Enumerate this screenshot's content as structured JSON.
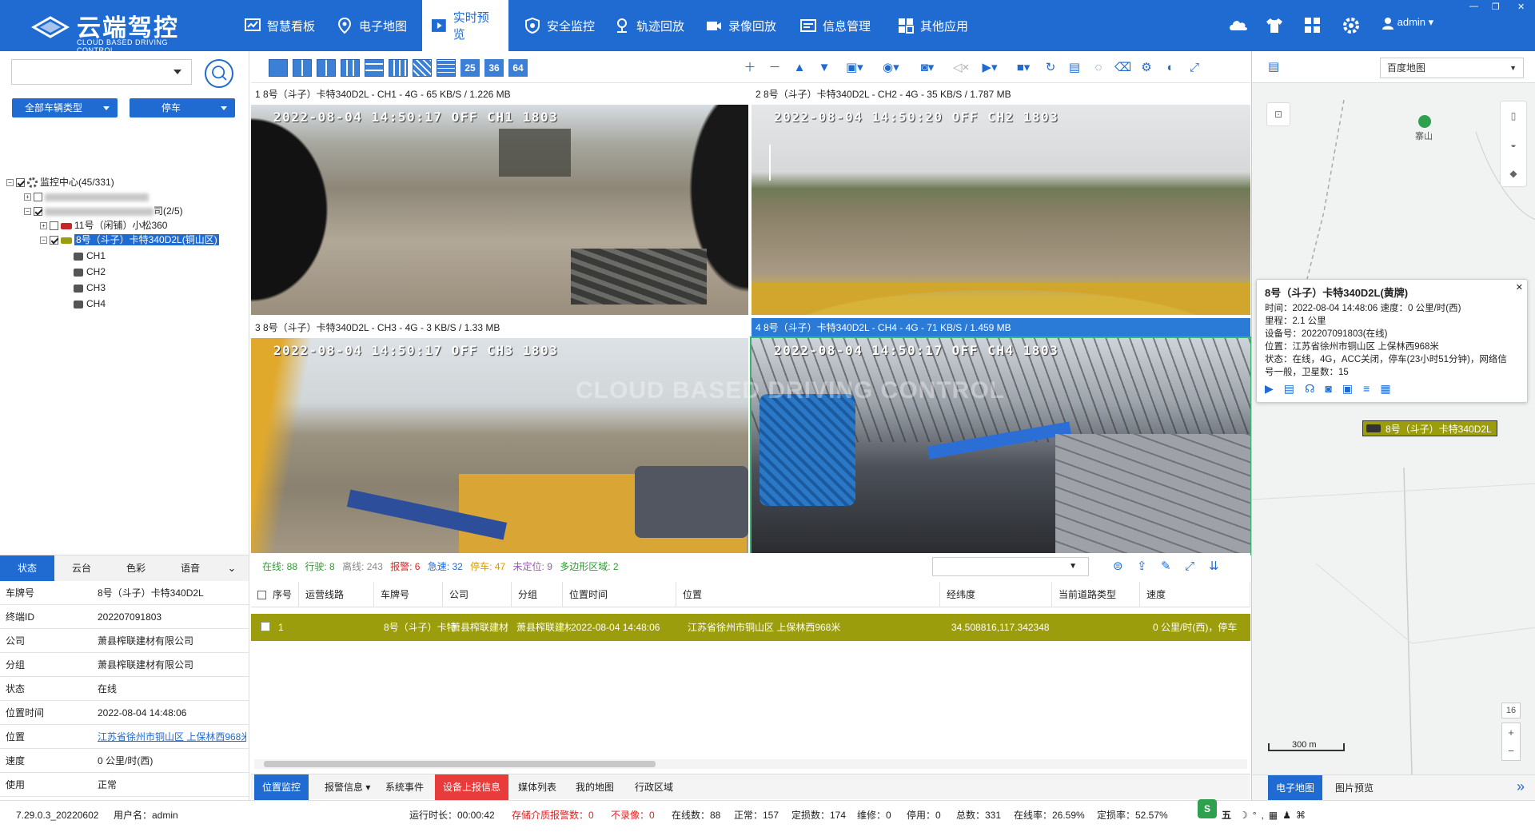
{
  "app": {
    "logo_main": "云端驾控",
    "logo_sub": "CLOUD BASED DRIVING CONTROL"
  },
  "nav": [
    {
      "label": "智慧看板",
      "icon": "chart-board-icon"
    },
    {
      "label": "电子地图",
      "icon": "map-pin-icon"
    },
    {
      "label": "实时预览",
      "icon": "play-screen-icon",
      "active": true
    },
    {
      "label": "安全监控",
      "icon": "shield-icon"
    },
    {
      "label": "轨迹回放",
      "icon": "location-icon"
    },
    {
      "label": "录像回放",
      "icon": "video-camera-icon"
    },
    {
      "label": "信息管理",
      "icon": "id-card-icon"
    },
    {
      "label": "其他应用",
      "icon": "apps-grid-icon"
    }
  ],
  "user": {
    "name": "admin"
  },
  "left": {
    "vehicle_type_btn": "全部车辆类型",
    "status_btn": "停车",
    "tree": {
      "root": "监控中心(45/331)",
      "group2_count": "司(2/5)",
      "vehicle11": "11号（闲铺）小松360",
      "vehicle8": "8号（斗子）卡特340D2L(铜山区)",
      "channels": [
        "CH1",
        "CH2",
        "CH3",
        "CH4"
      ]
    }
  },
  "info_tabs": [
    "状态",
    "云台",
    "色彩",
    "语音"
  ],
  "info": [
    {
      "k": "车牌号",
      "v": "8号（斗子）卡特340D2L"
    },
    {
      "k": "终端ID",
      "v": "202207091803"
    },
    {
      "k": "公司",
      "v": "萧县榨联建材有限公司"
    },
    {
      "k": "分组",
      "v": "萧县榨联建材有限公司"
    },
    {
      "k": "状态",
      "v": "在线"
    },
    {
      "k": "位置时间",
      "v": "2022-08-04 14:48:06"
    },
    {
      "k": "位置",
      "v": "江苏省徐州市铜山区 上保林西968米"
    },
    {
      "k": "速度",
      "v": "0 公里/时(西)"
    },
    {
      "k": "使用",
      "v": "正常"
    }
  ],
  "toolbar": {
    "layouts": [
      "25",
      "36",
      "64"
    ]
  },
  "videos": [
    {
      "header": "1 8号（斗子）卡特340D2L - CH1 - 4G - 65 KB/S / 1.226 MB",
      "overlay": "2022-08-04 14:50:17 OFF CH1 1803"
    },
    {
      "header": "2 8号（斗子）卡特340D2L - CH2 - 4G - 35 KB/S / 1.787 MB",
      "overlay": "2022-08-04 14:50:20 OFF CH2 1803"
    },
    {
      "header": "3 8号（斗子）卡特340D2L - CH3 - 4G - 3 KB/S / 1.33 MB",
      "overlay": "2022-08-04 14:50:17 OFF CH3 1803"
    },
    {
      "header": "4 8号（斗子）卡特340D2L - CH4 - 4G - 71 KB/S / 1.459 MB",
      "overlay": "2022-08-04 14:50:17 OFF CH4 1803"
    }
  ],
  "watermark": "CLOUD BASED DRIVING CONTROL",
  "stats": [
    {
      "label": "在线: 88",
      "color": "#2e9c2e"
    },
    {
      "label": "行驶: 8",
      "color": "#2e9c2e"
    },
    {
      "label": "离线: 243",
      "color": "#888888"
    },
    {
      "label": "报警: 6",
      "color": "#e02020"
    },
    {
      "label": "急速: 32",
      "color": "#1f6bd1"
    },
    {
      "label": "停车: 47",
      "color": "#d69a00"
    },
    {
      "label": "未定位: 9",
      "color": "#9b59b6"
    },
    {
      "label": "多边形区域: 2",
      "color": "#2e9c2e"
    }
  ],
  "table": {
    "columns": [
      "序号",
      "运营线路",
      "车牌号",
      "公司",
      "分组",
      "位置时间",
      "位置",
      "经纬度",
      "当前道路类型",
      "速度"
    ],
    "row": {
      "idx": "1",
      "plate": "8号（斗子）卡特",
      "company": "萧县榨联建材",
      "group": "萧县榨联建材",
      "time": "2022-08-04 14:48:06",
      "location": "江苏省徐州市铜山区 上保林西968米",
      "lnglat": "34.508816,117.342348",
      "speed": "0 公里/时(西)，停车"
    }
  },
  "bottom_tabs": [
    "位置监控",
    "报警信息",
    "系统事件",
    "设备上报信息",
    "媒体列表",
    "我的地图",
    "行政区域"
  ],
  "map": {
    "select": "百度地图",
    "place": "寨山",
    "popup": {
      "title": "8号（斗子）卡特340D2L(黄牌)",
      "time": "时间：2022-08-04 14:48:06     速度：0 公里/时(西)",
      "mileage": "里程：2.1 公里",
      "device": "设备号：202207091803(在线)",
      "location": "位置：江苏省徐州市铜山区 上保林西968米",
      "status1": "状态：在线，4G，ACC关闭，停车(23小时51分钟)，网络信",
      "status2": "号一般，卫星数：15"
    },
    "vehicle_label": "8号（斗子）卡特340D2L",
    "zoom": "16",
    "scale": "300 m",
    "tabs": [
      "电子地图",
      "图片预览"
    ]
  },
  "statusbar": {
    "version": "7.29.0.3_20220602",
    "user": "用户名：admin",
    "uptime": "运行时长：00:00:42",
    "storage_alarm": "存储介质报警数：0",
    "no_record": "不录像：0",
    "online": "在线数：88",
    "normal": "正常：157",
    "fault": "定损数：174",
    "repair": "维修：0",
    "stopped": "停用：0",
    "total": "总数：331",
    "online_rate": "在线率：26.59%",
    "fault_rate": "定损率：52.57%",
    "ime": "五"
  }
}
